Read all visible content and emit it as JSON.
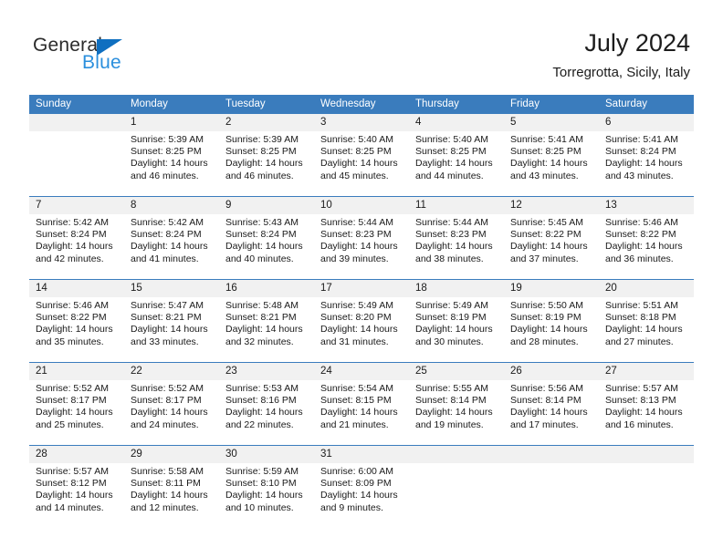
{
  "logo": {
    "word_one": "General",
    "word_two": "Blue",
    "triangle_icon": "triangle-icon",
    "color_primary": "#0f6fc0",
    "color_secondary": "#2b8fdd"
  },
  "header": {
    "title": "July 2024",
    "subtitle": "Torregrotta, Sicily, Italy"
  },
  "theme": {
    "header_blue": "#3a7cbd",
    "row_band_gray": "#f1f1f1",
    "text": "#1a1a1a"
  },
  "weekdays": [
    "Sunday",
    "Monday",
    "Tuesday",
    "Wednesday",
    "Thursday",
    "Friday",
    "Saturday"
  ],
  "weeks": [
    {
      "days": [
        {
          "num": "",
          "lines": []
        },
        {
          "num": "1",
          "lines": [
            "Sunrise: 5:39 AM",
            "Sunset: 8:25 PM",
            "Daylight: 14 hours",
            "and 46 minutes."
          ]
        },
        {
          "num": "2",
          "lines": [
            "Sunrise: 5:39 AM",
            "Sunset: 8:25 PM",
            "Daylight: 14 hours",
            "and 46 minutes."
          ]
        },
        {
          "num": "3",
          "lines": [
            "Sunrise: 5:40 AM",
            "Sunset: 8:25 PM",
            "Daylight: 14 hours",
            "and 45 minutes."
          ]
        },
        {
          "num": "4",
          "lines": [
            "Sunrise: 5:40 AM",
            "Sunset: 8:25 PM",
            "Daylight: 14 hours",
            "and 44 minutes."
          ]
        },
        {
          "num": "5",
          "lines": [
            "Sunrise: 5:41 AM",
            "Sunset: 8:25 PM",
            "Daylight: 14 hours",
            "and 43 minutes."
          ]
        },
        {
          "num": "6",
          "lines": [
            "Sunrise: 5:41 AM",
            "Sunset: 8:24 PM",
            "Daylight: 14 hours",
            "and 43 minutes."
          ]
        }
      ]
    },
    {
      "days": [
        {
          "num": "7",
          "lines": [
            "Sunrise: 5:42 AM",
            "Sunset: 8:24 PM",
            "Daylight: 14 hours",
            "and 42 minutes."
          ]
        },
        {
          "num": "8",
          "lines": [
            "Sunrise: 5:42 AM",
            "Sunset: 8:24 PM",
            "Daylight: 14 hours",
            "and 41 minutes."
          ]
        },
        {
          "num": "9",
          "lines": [
            "Sunrise: 5:43 AM",
            "Sunset: 8:24 PM",
            "Daylight: 14 hours",
            "and 40 minutes."
          ]
        },
        {
          "num": "10",
          "lines": [
            "Sunrise: 5:44 AM",
            "Sunset: 8:23 PM",
            "Daylight: 14 hours",
            "and 39 minutes."
          ]
        },
        {
          "num": "11",
          "lines": [
            "Sunrise: 5:44 AM",
            "Sunset: 8:23 PM",
            "Daylight: 14 hours",
            "and 38 minutes."
          ]
        },
        {
          "num": "12",
          "lines": [
            "Sunrise: 5:45 AM",
            "Sunset: 8:22 PM",
            "Daylight: 14 hours",
            "and 37 minutes."
          ]
        },
        {
          "num": "13",
          "lines": [
            "Sunrise: 5:46 AM",
            "Sunset: 8:22 PM",
            "Daylight: 14 hours",
            "and 36 minutes."
          ]
        }
      ]
    },
    {
      "days": [
        {
          "num": "14",
          "lines": [
            "Sunrise: 5:46 AM",
            "Sunset: 8:22 PM",
            "Daylight: 14 hours",
            "and 35 minutes."
          ]
        },
        {
          "num": "15",
          "lines": [
            "Sunrise: 5:47 AM",
            "Sunset: 8:21 PM",
            "Daylight: 14 hours",
            "and 33 minutes."
          ]
        },
        {
          "num": "16",
          "lines": [
            "Sunrise: 5:48 AM",
            "Sunset: 8:21 PM",
            "Daylight: 14 hours",
            "and 32 minutes."
          ]
        },
        {
          "num": "17",
          "lines": [
            "Sunrise: 5:49 AM",
            "Sunset: 8:20 PM",
            "Daylight: 14 hours",
            "and 31 minutes."
          ]
        },
        {
          "num": "18",
          "lines": [
            "Sunrise: 5:49 AM",
            "Sunset: 8:19 PM",
            "Daylight: 14 hours",
            "and 30 minutes."
          ]
        },
        {
          "num": "19",
          "lines": [
            "Sunrise: 5:50 AM",
            "Sunset: 8:19 PM",
            "Daylight: 14 hours",
            "and 28 minutes."
          ]
        },
        {
          "num": "20",
          "lines": [
            "Sunrise: 5:51 AM",
            "Sunset: 8:18 PM",
            "Daylight: 14 hours",
            "and 27 minutes."
          ]
        }
      ]
    },
    {
      "days": [
        {
          "num": "21",
          "lines": [
            "Sunrise: 5:52 AM",
            "Sunset: 8:17 PM",
            "Daylight: 14 hours",
            "and 25 minutes."
          ]
        },
        {
          "num": "22",
          "lines": [
            "Sunrise: 5:52 AM",
            "Sunset: 8:17 PM",
            "Daylight: 14 hours",
            "and 24 minutes."
          ]
        },
        {
          "num": "23",
          "lines": [
            "Sunrise: 5:53 AM",
            "Sunset: 8:16 PM",
            "Daylight: 14 hours",
            "and 22 minutes."
          ]
        },
        {
          "num": "24",
          "lines": [
            "Sunrise: 5:54 AM",
            "Sunset: 8:15 PM",
            "Daylight: 14 hours",
            "and 21 minutes."
          ]
        },
        {
          "num": "25",
          "lines": [
            "Sunrise: 5:55 AM",
            "Sunset: 8:14 PM",
            "Daylight: 14 hours",
            "and 19 minutes."
          ]
        },
        {
          "num": "26",
          "lines": [
            "Sunrise: 5:56 AM",
            "Sunset: 8:14 PM",
            "Daylight: 14 hours",
            "and 17 minutes."
          ]
        },
        {
          "num": "27",
          "lines": [
            "Sunrise: 5:57 AM",
            "Sunset: 8:13 PM",
            "Daylight: 14 hours",
            "and 16 minutes."
          ]
        }
      ]
    },
    {
      "days": [
        {
          "num": "28",
          "lines": [
            "Sunrise: 5:57 AM",
            "Sunset: 8:12 PM",
            "Daylight: 14 hours",
            "and 14 minutes."
          ]
        },
        {
          "num": "29",
          "lines": [
            "Sunrise: 5:58 AM",
            "Sunset: 8:11 PM",
            "Daylight: 14 hours",
            "and 12 minutes."
          ]
        },
        {
          "num": "30",
          "lines": [
            "Sunrise: 5:59 AM",
            "Sunset: 8:10 PM",
            "Daylight: 14 hours",
            "and 10 minutes."
          ]
        },
        {
          "num": "31",
          "lines": [
            "Sunrise: 6:00 AM",
            "Sunset: 8:09 PM",
            "Daylight: 14 hours",
            "and 9 minutes."
          ]
        },
        {
          "num": "",
          "lines": []
        },
        {
          "num": "",
          "lines": []
        },
        {
          "num": "",
          "lines": []
        }
      ]
    }
  ]
}
